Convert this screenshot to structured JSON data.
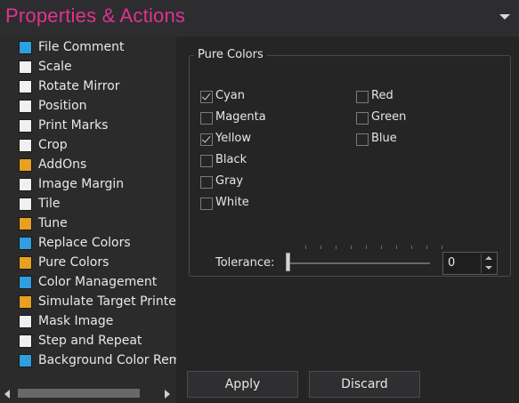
{
  "header": {
    "title": "Properties & Actions",
    "menu_icon": "chevron-down-icon"
  },
  "sidebar": {
    "items": [
      {
        "label": "File Comment",
        "icon": "file-comment-icon",
        "color": "#2f9fe0"
      },
      {
        "label": "Scale",
        "icon": "scale-icon",
        "color": "#f0f0f0"
      },
      {
        "label": "Rotate Mirror",
        "icon": "rotate-mirror-icon",
        "color": "#f0f0f0"
      },
      {
        "label": "Position",
        "icon": "position-icon",
        "color": "#f0f0f0"
      },
      {
        "label": "Print Marks",
        "icon": "print-marks-icon",
        "color": "#f0f0f0"
      },
      {
        "label": "Crop",
        "icon": "crop-icon",
        "color": "#f0f0f0"
      },
      {
        "label": "AddOns",
        "icon": "addons-icon",
        "color": "#e8a020"
      },
      {
        "label": "Image Margin",
        "icon": "image-margin-icon",
        "color": "#f0f0f0"
      },
      {
        "label": "Tile",
        "icon": "tile-icon",
        "color": "#f0f0f0"
      },
      {
        "label": "Tune",
        "icon": "tune-icon",
        "color": "#e8a020"
      },
      {
        "label": "Replace Colors",
        "icon": "replace-colors-icon",
        "color": "#2f9fe0"
      },
      {
        "label": "Pure Colors",
        "icon": "pure-colors-icon",
        "color": "#e8a020"
      },
      {
        "label": "Color Management",
        "icon": "color-management-icon",
        "color": "#2f9fe0"
      },
      {
        "label": "Simulate Target Printer",
        "icon": "simulate-printer-icon",
        "color": "#e8a020"
      },
      {
        "label": "Mask Image",
        "icon": "mask-image-icon",
        "color": "#f0f0f0"
      },
      {
        "label": "Step and Repeat",
        "icon": "step-repeat-icon",
        "color": "#f0f0f0"
      },
      {
        "label": "Background Color Remo",
        "icon": "background-color-icon",
        "color": "#2f9fe0"
      }
    ]
  },
  "pure_colors": {
    "legend": "Pure Colors",
    "left_column": [
      {
        "label": "Cyan",
        "checked": true
      },
      {
        "label": "Magenta",
        "checked": false
      },
      {
        "label": "Yellow",
        "checked": true
      },
      {
        "label": "Black",
        "checked": false
      },
      {
        "label": "Gray",
        "checked": false
      },
      {
        "label": "White",
        "checked": false
      }
    ],
    "right_column": [
      {
        "label": "Red",
        "checked": false
      },
      {
        "label": "Green",
        "checked": false
      },
      {
        "label": "Blue",
        "checked": false
      }
    ],
    "tolerance_label": "Tolerance:",
    "tolerance_value": "0"
  },
  "actions": {
    "apply": "Apply",
    "discard": "Discard"
  },
  "colors": {
    "accent": "#e0338e",
    "background": "#252526"
  }
}
